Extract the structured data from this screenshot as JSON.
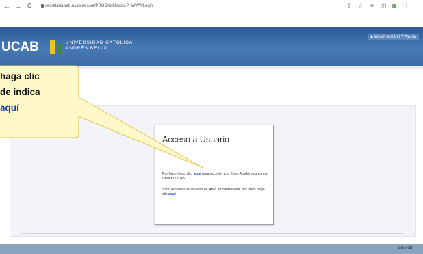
{
  "browser": {
    "url": "secretariaweb.ucab.edu.ve/PROD/twbkwbis.P_WWWLogin",
    "back_glyph": "←",
    "forward_glyph": "→",
    "reload_glyph": "C"
  },
  "header": {
    "logo": "UCAB",
    "university_line1": "UNIVERSIDAD CATÓLICA",
    "university_line2": "ANDRÉS BELLO",
    "login_link": "Iniciar sesión",
    "help_link": "Ayuda",
    "brand_color": "#2c5b96",
    "accent_color": "#f0c21a"
  },
  "login": {
    "title": "Acceso a Usuario",
    "para1_before": "Por favor haga clic: ",
    "para1_link": "aquí",
    "para1_after": " para acceder a la Zona Académica con su usuario UCAB.",
    "para2_before": "Si no recuerda su usuario UCAB o su contraseña, por favor haga clic ",
    "para2_link": "aquí"
  },
  "callout": {
    "line1": "haga clic",
    "line2": "de indica",
    "line3": "aquí",
    "fill_color": "#fff8c8",
    "border_color": "#e6c34a"
  },
  "footer": {
    "brand": "ellucian."
  },
  "icons": [
    "back-icon",
    "forward-icon",
    "reload-icon",
    "lock-icon",
    "share-icon",
    "star-icon",
    "bookmark-icon",
    "window-icon",
    "extension-icon",
    "menu-icon"
  ]
}
